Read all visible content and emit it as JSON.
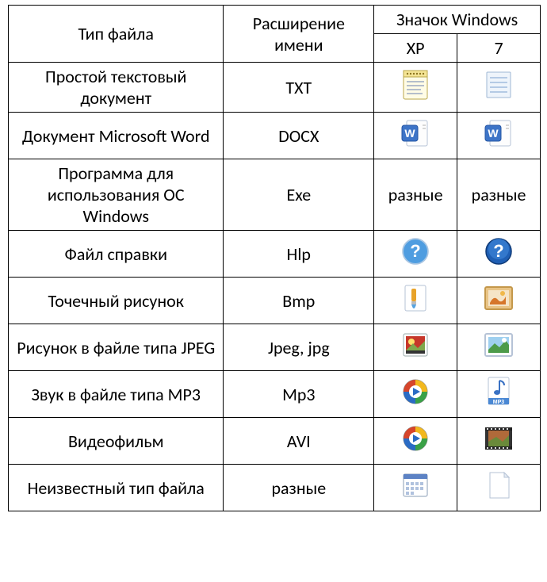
{
  "header": {
    "col1": "Тип файла",
    "col2": "Расширение имени",
    "col3_group": "Значок Windows",
    "col3_a": "XP",
    "col3_b": "7"
  },
  "rows": [
    {
      "type": "Простой текстовый документ",
      "ext": "TXT",
      "xp_icon": "notepad-xp",
      "w7_icon": "notepad-7"
    },
    {
      "type": "Документ Microsoft Word",
      "ext": "DOCX",
      "xp_icon": "word-doc",
      "w7_icon": "word-doc"
    },
    {
      "type": "Программа для использования ОС Windows",
      "ext": "Exe",
      "xp_text": "разные",
      "w7_text": "разные"
    },
    {
      "type": "Файл справки",
      "ext": "Hlp",
      "xp_icon": "help-xp",
      "w7_icon": "help-7"
    },
    {
      "type": "Точечный рисунок",
      "ext": "Bmp",
      "xp_icon": "bmp-xp",
      "w7_icon": "bmp-7"
    },
    {
      "type": "Рисунок в файле типа JPEG",
      "ext": "Jpeg, jpg",
      "xp_icon": "jpeg-xp",
      "w7_icon": "jpeg-7"
    },
    {
      "type": "Звук в файле типа MP3",
      "ext": "Mp3",
      "xp_icon": "mp3-xp",
      "w7_icon": "mp3-7"
    },
    {
      "type": "Видеофильм",
      "ext": "AVI",
      "xp_icon": "avi-xp",
      "w7_icon": "avi-7"
    },
    {
      "type": "Неизвестный тип файла",
      "ext": "разные",
      "xp_icon": "unknown-xp",
      "w7_icon": "unknown-7"
    }
  ]
}
